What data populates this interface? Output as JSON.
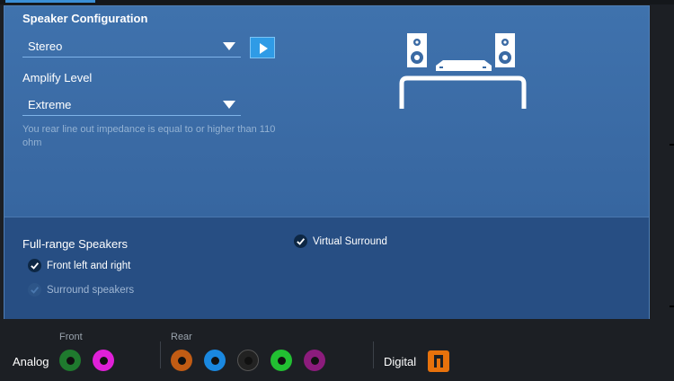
{
  "speaker_config": {
    "title": "Speaker Configuration",
    "selected": "Stereo"
  },
  "amplify": {
    "label": "Amplify Level",
    "selected": "Extreme",
    "note": "You rear line out impedance is equal to or higher than 110 ohm"
  },
  "full_range": {
    "label": "Full-range Speakers",
    "front": {
      "label": "Front left and right",
      "checked": true
    },
    "surround": {
      "label": "Surround speakers",
      "checked": true,
      "disabled": true
    }
  },
  "virtual_surround": {
    "label": "Virtual Surround",
    "checked": true
  },
  "jacks": {
    "analog_label": "Analog",
    "front_label": "Front",
    "rear_label": "Rear",
    "digital_label": "Digital",
    "front": [
      {
        "name": "front-green-jack",
        "color": "#1f7a2e"
      },
      {
        "name": "front-pink-jack",
        "color": "#e020d8"
      }
    ],
    "rear": [
      {
        "name": "rear-orange-jack",
        "color": "#c25c14"
      },
      {
        "name": "rear-blue-jack",
        "color": "#1a88e0"
      },
      {
        "name": "rear-black-jack",
        "color": "#222222"
      },
      {
        "name": "rear-green-jack",
        "color": "#22c032"
      },
      {
        "name": "rear-purple-jack",
        "color": "#8c1c7c"
      }
    ]
  },
  "colors": {
    "accent": "#2f9be6",
    "panel": "#3a6aa4",
    "digital": "#e8720c"
  },
  "icons": {
    "play": "play-icon",
    "speakers": "speaker-setup-icon",
    "check": "check-icon",
    "digital": "spdif-icon"
  }
}
